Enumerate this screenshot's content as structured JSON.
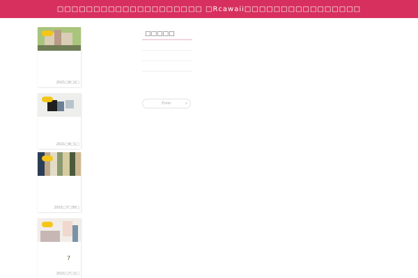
{
  "header": {
    "title": "□□□□□□□□□□□□□□□□□□□□ □Rcawaii□□□□□□□□□□□□□□□□",
    "bg_color": "#d7305e"
  },
  "posts": [
    {
      "date": "2021□8□2□",
      "extra": ""
    },
    {
      "date": "2021□8□1□",
      "extra": ""
    },
    {
      "date": "2021□7□30□",
      "extra": ""
    },
    {
      "date": "2021□7□1□",
      "extra": "7"
    }
  ],
  "sidebar": {
    "widget_title": "□□□□□",
    "search_placeholder": "Enter",
    "search_icon_glyph": "⌕"
  }
}
